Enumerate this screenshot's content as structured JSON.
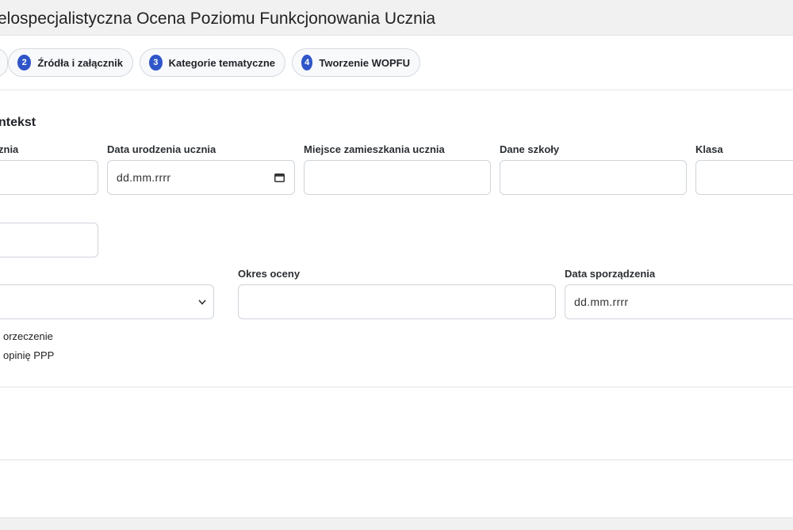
{
  "header": {
    "title": "elospecjalistyczna Ocena Poziomu Funkcjonowania Ucznia"
  },
  "steps": [
    {
      "num": "2",
      "label": "Źródła i załącznik"
    },
    {
      "num": "3",
      "label": "Kategorie tematyczne"
    },
    {
      "num": "4",
      "label": "Tworzenie WOPFU"
    }
  ],
  "section": {
    "title": "ntekst"
  },
  "fields": {
    "name_label": "znia",
    "dob_label": "Data urodzenia ucznia",
    "dob_placeholder": "dd.mm.rrrr",
    "residence_label": "Miejsce zamieszkania ucznia",
    "school_label": "Dane szkoły",
    "class_label": "Klasa",
    "period_label": "Okres oceny",
    "created_label": "Data sporządzenia",
    "created_placeholder": "dd.mm.rrrr"
  },
  "checkboxes": [
    {
      "label": "orzeczenie"
    },
    {
      "label": "opinię PPP"
    }
  ],
  "icons": {
    "calendar": "calendar-icon",
    "select_arrow": "chevron-down-icon"
  },
  "colors": {
    "accent": "#2f55c9",
    "border": "#ced4da",
    "topbar": "#f1f1f2"
  }
}
